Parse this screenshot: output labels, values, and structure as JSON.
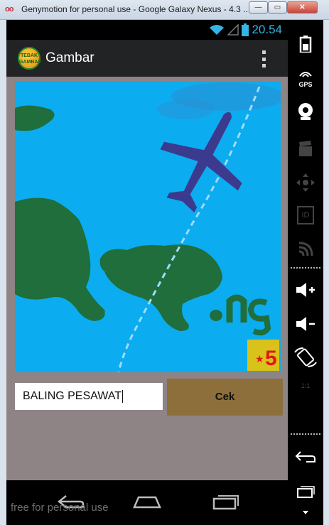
{
  "window": {
    "title": "Genymotion for personal use - Google Galaxy Nexus - 4.3 ...",
    "logo_text": "oo",
    "minimize_label": "—",
    "maximize_label": "▭",
    "close_label": "✕"
  },
  "statusbar": {
    "time": "20.54"
  },
  "actionbar": {
    "logo_text": "TEBAK GAMBAR",
    "title": "Gambar"
  },
  "puzzle": {
    "hint_text": ". ng",
    "level_star": "★",
    "level_number": "5"
  },
  "answer": {
    "value": "BALING PESAWAT"
  },
  "cek_button": {
    "label": "Cek"
  },
  "watermark": "free for personal use",
  "sidebar": {
    "items": [
      "battery-icon",
      "gps-icon",
      "webcam-icon",
      "clapper-icon",
      "dpad-icon",
      "id-icon",
      "cast-icon",
      "volume-up-icon",
      "volume-down-icon",
      "rotate-icon",
      "scale-icon",
      "back-icon",
      "recent-apps-icon",
      "menu-down-icon"
    ],
    "gps_label": "GPS",
    "id_label": "ID",
    "scale_label": "1:1"
  },
  "colors": {
    "sea": "#0cacf0",
    "land": "#1f6e3c",
    "plane": "#3b3a8f",
    "status_accent": "#33b5e5",
    "cek_button": "#8c6f3a",
    "content_bg": "#8e8486",
    "level_badge": "#d9c21a",
    "level_text": "#e01818"
  }
}
